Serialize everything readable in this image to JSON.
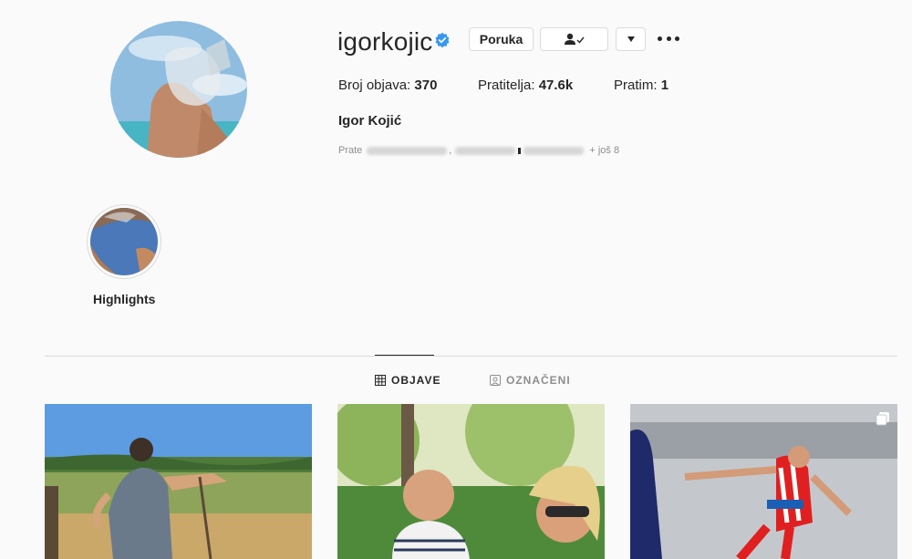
{
  "profile": {
    "username": "igorkojic",
    "full_name": "Igor Kojić",
    "verified": true
  },
  "actions": {
    "message_label": "Poruka",
    "following_icon": "person-check-icon",
    "dropdown_icon": "caret-down-icon",
    "more_icon": "more-dots-icon"
  },
  "stats": {
    "posts_label": "Broj objava:",
    "posts_value": "370",
    "followers_label": "Pratitelja:",
    "followers_value": "47.6k",
    "following_label": "Pratim:",
    "following_value": "1"
  },
  "followed_by": {
    "prefix": "Prate",
    "separator": ",",
    "suffix": "+ još 8"
  },
  "highlights": [
    {
      "label": "Highlights"
    }
  ],
  "tabs": [
    {
      "label": "OBJAVE",
      "icon": "grid-icon",
      "active": true
    },
    {
      "label": "OZNAČENI",
      "icon": "tagged-icon",
      "active": false
    }
  ],
  "posts": [
    {
      "icon": "photo"
    },
    {
      "icon": "photo"
    },
    {
      "icon": "carousel-icon"
    }
  ],
  "colors": {
    "verified": "#3897f0",
    "text": "#262626",
    "muted": "#8e8e8e",
    "border": "#dbdbdb"
  }
}
